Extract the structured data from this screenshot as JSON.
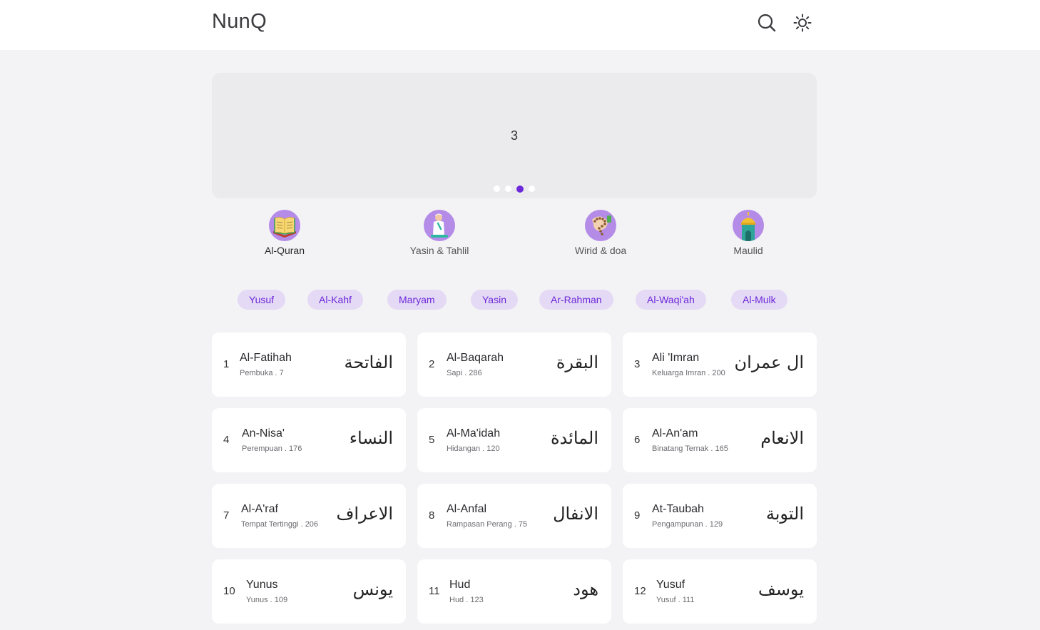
{
  "app": {
    "title": "NunQ"
  },
  "header": {
    "search_icon": "search-icon",
    "theme_icon": "sun-icon"
  },
  "carousel": {
    "current_slide_label": "3",
    "dots": [
      false,
      false,
      true,
      false
    ]
  },
  "menu": [
    {
      "label": "Al-Quran",
      "icon": "quran-book-icon"
    },
    {
      "label": "Yasin & Tahlil",
      "icon": "praying-person-icon"
    },
    {
      "label": "Wirid & doa",
      "icon": "prayer-beads-icon"
    },
    {
      "label": "Maulid",
      "icon": "mosque-icon"
    }
  ],
  "chips": [
    "Yusuf",
    "Al-Kahf",
    "Maryam",
    "Yasin",
    "Ar-Rahman",
    "Al-Waqi'ah",
    "Al-Mulk"
  ],
  "surahs": [
    {
      "number": "1",
      "name": "Al-Fatihah",
      "meaning": "Pembuka",
      "verses": "7",
      "arabic": "الفاتحة"
    },
    {
      "number": "2",
      "name": "Al-Baqarah",
      "meaning": "Sapi",
      "verses": "286",
      "arabic": "البقرة"
    },
    {
      "number": "3",
      "name": "Ali 'Imran",
      "meaning": "Keluarga Imran",
      "verses": "200",
      "arabic": "ال عمران"
    },
    {
      "number": "4",
      "name": "An-Nisa'",
      "meaning": "Perempuan",
      "verses": "176",
      "arabic": "النساء"
    },
    {
      "number": "5",
      "name": "Al-Ma'idah",
      "meaning": "Hidangan",
      "verses": "120",
      "arabic": "المائدة"
    },
    {
      "number": "6",
      "name": "Al-An'am",
      "meaning": "Binatang Ternak",
      "verses": "165",
      "arabic": "الانعام"
    },
    {
      "number": "7",
      "name": "Al-A'raf",
      "meaning": "Tempat Tertinggi",
      "verses": "206",
      "arabic": "الاعراف"
    },
    {
      "number": "8",
      "name": "Al-Anfal",
      "meaning": "Rampasan Perang",
      "verses": "75",
      "arabic": "الانفال"
    },
    {
      "number": "9",
      "name": "At-Taubah",
      "meaning": "Pengampunan",
      "verses": "129",
      "arabic": "التوبة"
    },
    {
      "number": "10",
      "name": "Yunus",
      "meaning": "Yunus",
      "verses": "109",
      "arabic": "يونس"
    },
    {
      "number": "11",
      "name": "Hud",
      "meaning": "Hud",
      "verses": "123",
      "arabic": "هود"
    },
    {
      "number": "12",
      "name": "Yusuf",
      "meaning": "Yusuf",
      "verses": "111",
      "arabic": "يوسف"
    }
  ],
  "colors": {
    "accent": "#6d28d9",
    "chip_bg": "#e4daf5",
    "menu_circle": "#b48ce8",
    "page_bg": "#f3f2f5",
    "card_bg": "#ffffff"
  }
}
